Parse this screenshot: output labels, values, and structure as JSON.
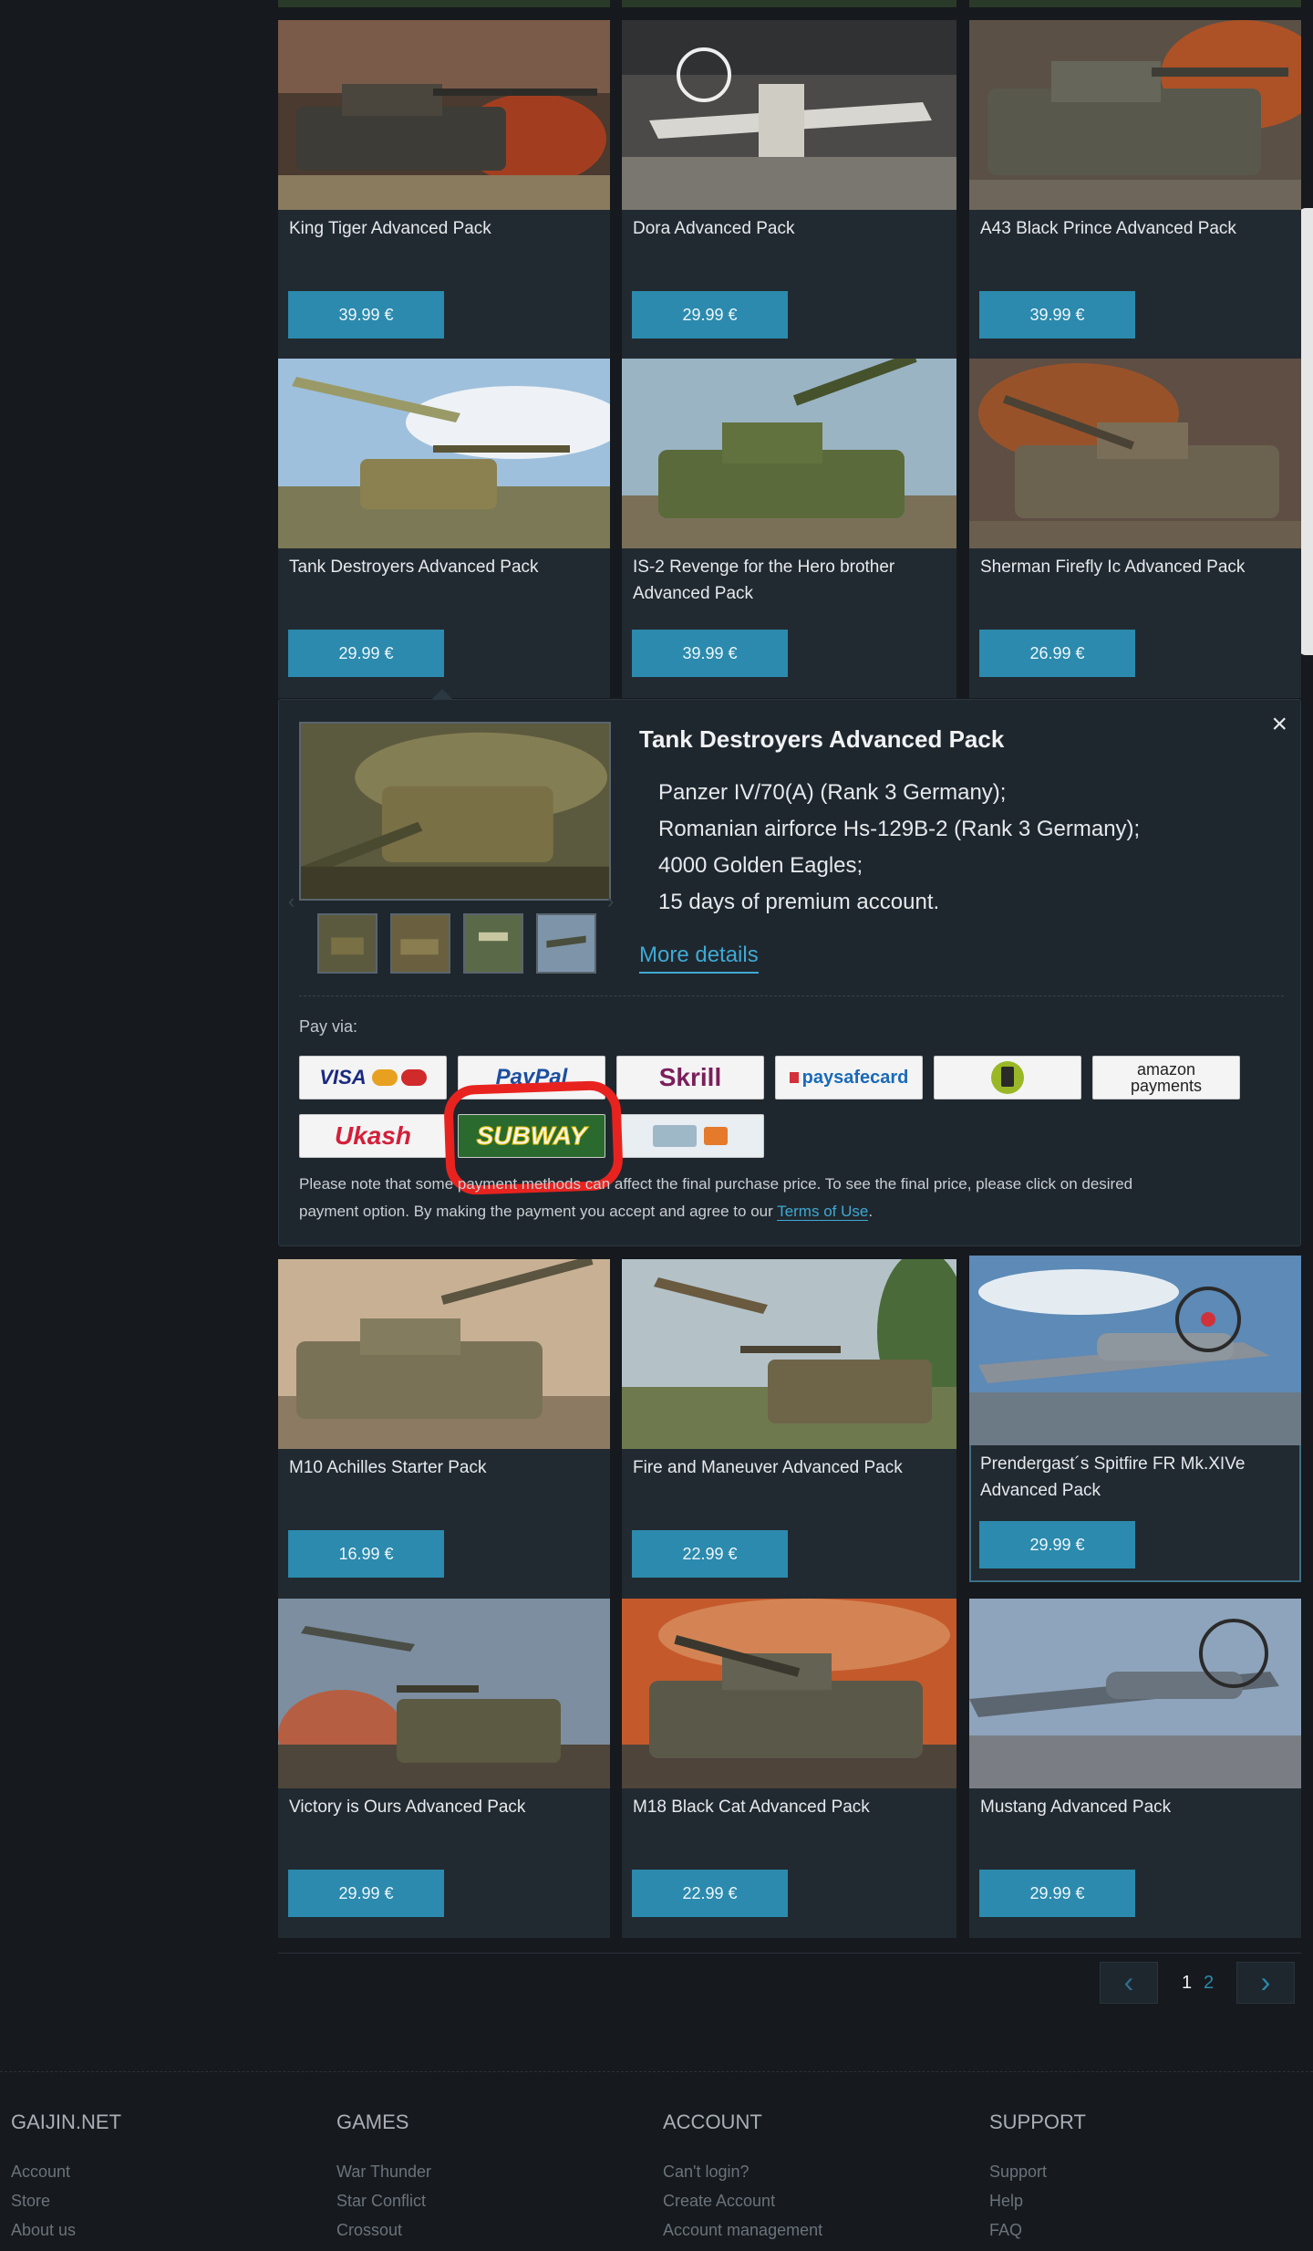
{
  "products": [
    {
      "title": "King Tiger Advanced Pack",
      "price": "39.99 €"
    },
    {
      "title": "Dora Advanced Pack",
      "price": "29.99 €"
    },
    {
      "title": "A43 Black Prince Advanced Pack",
      "price": "39.99 €"
    },
    {
      "title": "Tank Destroyers Advanced Pack",
      "price": "29.99 €"
    },
    {
      "title": "IS-2 Revenge for the Hero brother Advanced Pack",
      "price": "39.99 €"
    },
    {
      "title": "Sherman Firefly Ic Advanced Pack",
      "price": "26.99 €"
    },
    {
      "title": "M10 Achilles Starter Pack",
      "price": "16.99 €"
    },
    {
      "title": "Fire and Maneuver Advanced Pack",
      "price": "22.99 €"
    },
    {
      "title": "Prendergast´s Spitfire FR Mk.XIVe Advanced Pack",
      "price": "29.99 €"
    },
    {
      "title": "Victory is Ours Advanced Pack",
      "price": "29.99 €"
    },
    {
      "title": "M18 Black Cat Advanced Pack",
      "price": "22.99 €"
    },
    {
      "title": "Mustang Advanced Pack",
      "price": "29.99 €"
    }
  ],
  "detail": {
    "title": "Tank Destroyers Advanced Pack",
    "items": [
      "Panzer IV/70(A) (Rank 3 Germany);",
      "Romanian airforce Hs-129B-2 (Rank 3 Germany);",
      "4000 Golden Eagles;",
      "15 days of premium account."
    ],
    "more_details": "More details",
    "close": "×",
    "pay_via": "Pay via:",
    "payment_methods": [
      "VISA",
      "PayPal",
      "Skrill",
      "paysafecard",
      "mobile",
      "amazon payments",
      "Ukash",
      "SUBWAY",
      "bank transfer"
    ],
    "note_line1": "Please note that some payment methods can affect the final purchase price. To see the final price, please click on desired",
    "note_line2": "payment option. By making the payment you accept and agree to our",
    "terms": "Terms of Use",
    "note_end": "."
  },
  "pagination": {
    "current": "1",
    "next": "2"
  },
  "footer": {
    "columns": [
      {
        "heading": "GAIJIN.NET",
        "links": [
          "Account",
          "Store",
          "About us"
        ]
      },
      {
        "heading": "GAMES",
        "links": [
          "War Thunder",
          "Star Conflict",
          "Crossout"
        ]
      },
      {
        "heading": "ACCOUNT",
        "links": [
          "Can't login?",
          "Create Account",
          "Account management"
        ]
      },
      {
        "heading": "SUPPORT",
        "links": [
          "Support",
          "Help",
          "FAQ"
        ]
      }
    ]
  },
  "colors": {
    "accent": "#2b8aad",
    "annotation": "#e8231f",
    "background": "#16191d",
    "card": "#222a31"
  }
}
